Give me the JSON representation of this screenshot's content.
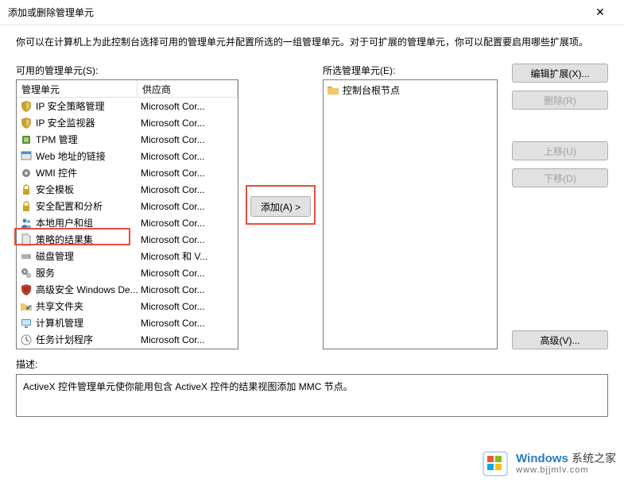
{
  "window": {
    "title": "添加或删除管理单元",
    "close_label": "✕"
  },
  "intro": "你可以在计算机上为此控制台选择可用的管理单元并配置所选的一组管理单元。对于可扩展的管理单元，你可以配置要启用哪些扩展项。",
  "available": {
    "label": "可用的管理单元(S):",
    "col_name": "管理单元",
    "col_vendor": "供应商",
    "items": [
      {
        "name": "IP 安全策略管理",
        "vendor": "Microsoft Cor...",
        "icon": "shield"
      },
      {
        "name": "IP 安全监视器",
        "vendor": "Microsoft Cor...",
        "icon": "shield"
      },
      {
        "name": "TPM 管理",
        "vendor": "Microsoft Cor...",
        "icon": "chip"
      },
      {
        "name": "Web 地址的链接",
        "vendor": "Microsoft Cor...",
        "icon": "link"
      },
      {
        "name": "WMI 控件",
        "vendor": "Microsoft Cor...",
        "icon": "gear"
      },
      {
        "name": "安全模板",
        "vendor": "Microsoft Cor...",
        "icon": "lock"
      },
      {
        "name": "安全配置和分析",
        "vendor": "Microsoft Cor...",
        "icon": "lock"
      },
      {
        "name": "本地用户和组",
        "vendor": "Microsoft Cor...",
        "icon": "users"
      },
      {
        "name": "策略的结果集",
        "vendor": "Microsoft Cor...",
        "icon": "doc"
      },
      {
        "name": "磁盘管理",
        "vendor": "Microsoft 和 V...",
        "icon": "disk"
      },
      {
        "name": "服务",
        "vendor": "Microsoft Cor...",
        "icon": "gears"
      },
      {
        "name": "高级安全 Windows De...",
        "vendor": "Microsoft Cor...",
        "icon": "firewall"
      },
      {
        "name": "共享文件夹",
        "vendor": "Microsoft Cor...",
        "icon": "folder-share"
      },
      {
        "name": "计算机管理",
        "vendor": "Microsoft Cor...",
        "icon": "computer"
      },
      {
        "name": "任务计划程序",
        "vendor": "Microsoft Cor...",
        "icon": "clock"
      }
    ]
  },
  "selected": {
    "label": "所选管理单元(E):",
    "root": "控制台根节点"
  },
  "buttons": {
    "add": "添加(A) >",
    "edit_ext": "编辑扩展(X)...",
    "remove": "删除(R)",
    "move_up": "上移(U)",
    "move_down": "下移(D)",
    "advanced": "高级(V)..."
  },
  "description": {
    "label": "描述:",
    "text": "ActiveX 控件管理单元使你能用包含 ActiveX 控件的结果视图添加 MMC 节点。"
  },
  "watermark": {
    "brand_en": "Windows",
    "brand_zh": "系统之家",
    "url": "www.bjjmlv.com"
  }
}
